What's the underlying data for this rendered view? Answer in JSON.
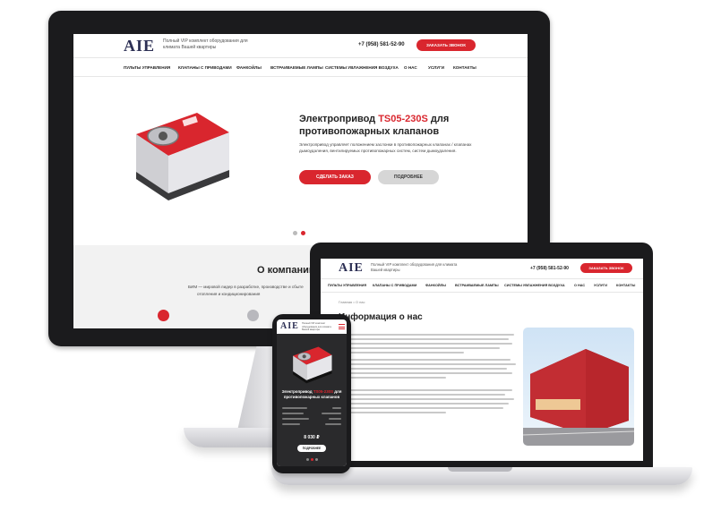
{
  "brand": {
    "logo": "AIE",
    "tagline": "Полный VIP комплект оборудования для климата Вашей квартиры",
    "accent_color": "#d9262e",
    "dark_color": "#2c2f54"
  },
  "desktop": {
    "header": {
      "phone": "+7 (958) 581-52-90",
      "callback_button": "ЗАКАЗАТЬ ЗВОНОК"
    },
    "nav": [
      "ПУЛЬТЫ УПРАВЛЕНИЯ",
      "КЛАПАНЫ С ПРИВОДАМИ",
      "ФАНКОЙЛЫ",
      "ВСТРАИВАЕМЫЕ ЛАМПЫ",
      "СИСТЕМЫ УВЛАЖНЕНИЯ ВОЗДУХА",
      "О НАС",
      "УСЛУГИ",
      "КОНТАКТЫ"
    ],
    "slide": {
      "title_prefix": "Электропривод ",
      "title_model": "TS05-230S",
      "title_suffix": " для противопожарных клапанов",
      "description": "Электропривод управляет положением заслонки в противопожарных клапанах / клапанах дымоудаления, вентилируемых противопожарных систем, систем дымоудаления.",
      "order_button": "СДЕЛАТЬ ЗАКАЗ",
      "more_button": "ПОДРОБНЕЕ",
      "slide_count": 2,
      "active_slide": 2
    },
    "about": {
      "title": "О компании",
      "line1": "БИМ — мировой лидер в разработке, производстве и сбыте",
      "line2": "отопления и кондиционирования"
    }
  },
  "laptop": {
    "header": {
      "phone": "+7 (958) 581-52-90",
      "callback_button": "ЗАКАЗАТЬ ЗВОНОК"
    },
    "nav": [
      "ПУЛЬТЫ УПРАВЛЕНИЯ",
      "КЛАПАНЫ С ПРИВОДАМИ",
      "ФАНКОЙЛЫ",
      "ВСТРАИВАЕМЫЕ ЛАМПЫ",
      "СИСТЕМЫ УВЛАЖНЕНИЯ ВОЗДУХА",
      "О НАС",
      "УСЛУГИ",
      "КОНТАКТЫ"
    ],
    "breadcrumb": "Главная  •  О нас",
    "page_title": "Информация о нас"
  },
  "phone": {
    "slide_title_prefix": "Электропривод ",
    "slide_title_model": "TS05-230S",
    "slide_title_suffix": " для противопожарных клапанов",
    "price": "8 030 ₽",
    "more_button": "ПОДРОБНЕЕ"
  }
}
